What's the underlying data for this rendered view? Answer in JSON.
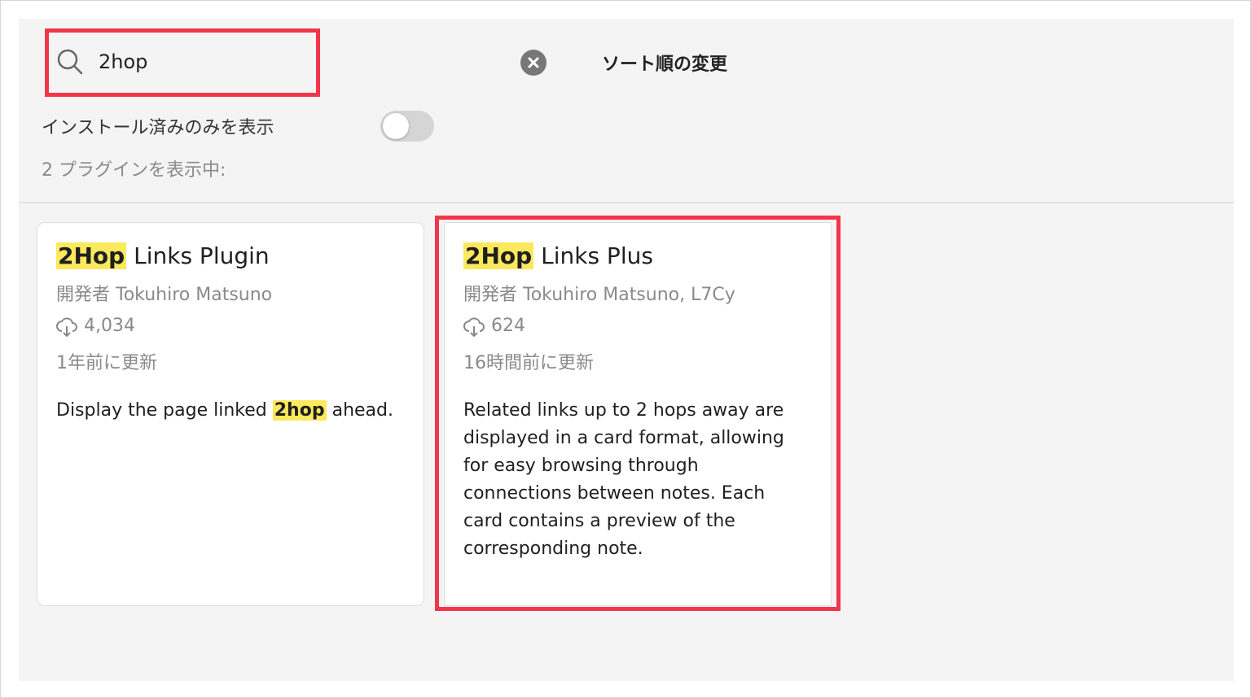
{
  "search": {
    "value": "2hop",
    "placeholder": ""
  },
  "sort": {
    "label": "ソート順の変更"
  },
  "filter": {
    "installed_only_label": "インストール済みのみを表示",
    "installed_only_enabled": false
  },
  "results": {
    "count_label": "2 プラグインを表示中:"
  },
  "plugins": [
    {
      "title_highlight": "2Hop",
      "title_rest": " Links Plugin",
      "author": "開発者 Tokuhiro Matsuno",
      "downloads": "4,034",
      "updated": "1年前に更新",
      "description_before": "Display the page linked ",
      "description_highlight": "2hop",
      "description_after": " ahead."
    },
    {
      "title_highlight": "2Hop",
      "title_rest": " Links Plus",
      "author": "開発者 Tokuhiro Matsuno, L7Cy",
      "downloads": "624",
      "updated": "16時間前に更新",
      "description": "Related links up to 2 hops away are displayed in a card format, allowing for easy browsing through connections between notes. Each card contains a preview of the corresponding note."
    }
  ],
  "colors": {
    "highlight": "#fbe95d",
    "annotation_box": "#f0364b",
    "panel_bg": "#f4f4f4"
  }
}
